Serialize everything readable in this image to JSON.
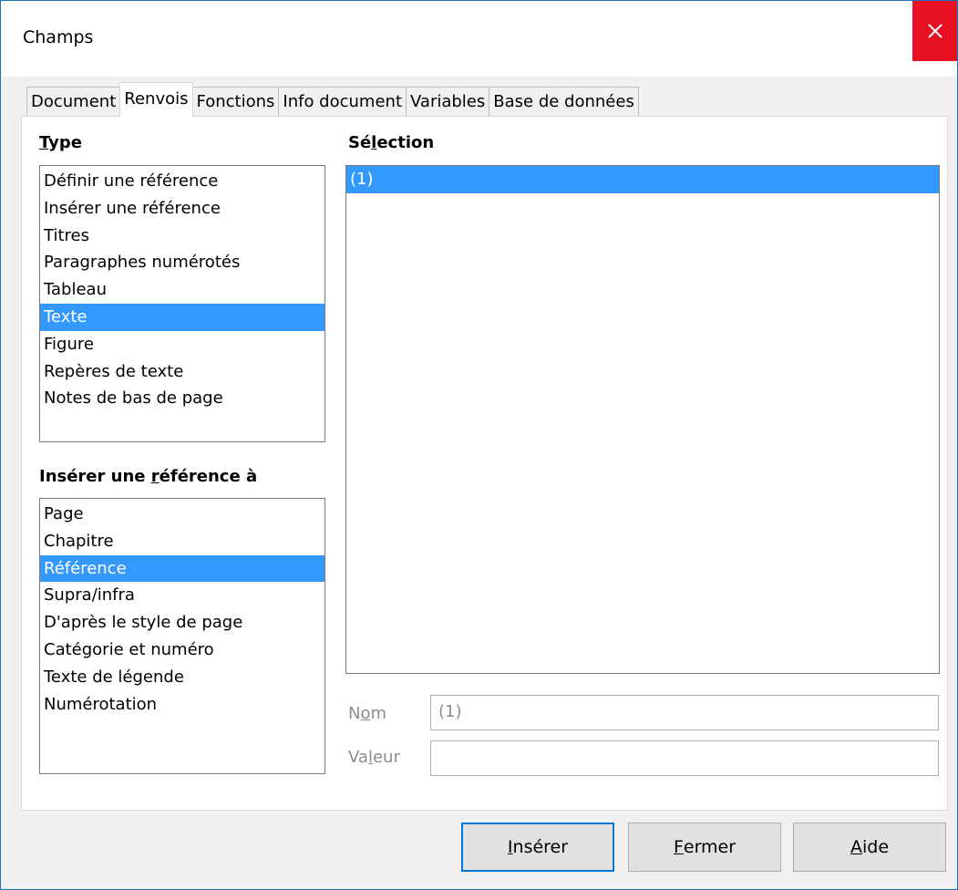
{
  "window": {
    "title": "Champs",
    "close_glyph": "✕"
  },
  "tabs": [
    {
      "label": "Document",
      "active": false
    },
    {
      "label": "Renvois",
      "active": true
    },
    {
      "label": "Fonctions",
      "active": false
    },
    {
      "label": "Info document",
      "active": false
    },
    {
      "label": "Variables",
      "active": false
    },
    {
      "label": "Base de données",
      "active": false
    }
  ],
  "type_section": {
    "label_u": "T",
    "label_rest": "ype",
    "items": [
      "Définir une référence",
      "Insérer une référence",
      "Titres",
      "Paragraphes numérotés",
      "Tableau",
      "Texte",
      "Figure",
      "Repères de texte",
      "Notes de bas de page"
    ],
    "selected": "Texte"
  },
  "insert_ref_section": {
    "label_pre": "Insérer une ",
    "label_u": "r",
    "label_post": "éférence à",
    "items": [
      "Page",
      "Chapitre",
      "Référence",
      "Supra/infra",
      "D'après le style de page",
      "Catégorie et numéro",
      "Texte de légende",
      "Numérotation"
    ],
    "selected": "Référence"
  },
  "selection_section": {
    "label_pre": "Sé",
    "label_u": "l",
    "label_post": "ection",
    "items": [
      "(1)"
    ],
    "selected": "(1)"
  },
  "fields": {
    "name_label_pre": "N",
    "name_label_u": "o",
    "name_label_post": "m",
    "name_value": "(1)",
    "value_label_pre": "Va",
    "value_label_u": "l",
    "value_label_post": "eur",
    "value_value": ""
  },
  "buttons": {
    "insert_u": "I",
    "insert_rest": "nsérer",
    "close_u": "F",
    "close_rest": "ermer",
    "help_u": "A",
    "help_rest": "ide"
  },
  "colors": {
    "selection": "#3399ff",
    "close_button": "#e81123",
    "default_button_border": "#0078d7"
  }
}
